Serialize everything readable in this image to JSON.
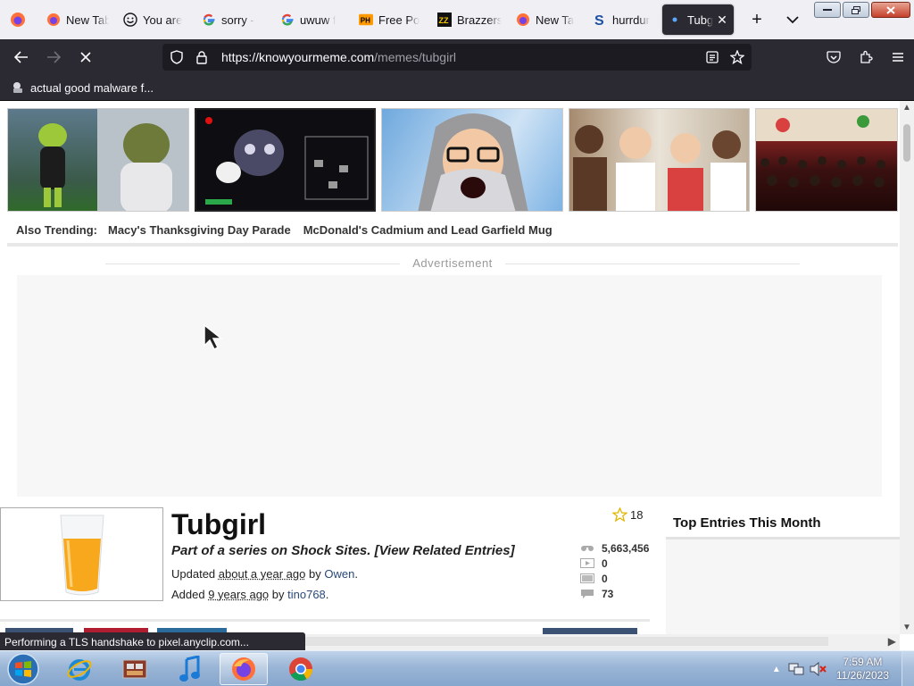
{
  "browser": {
    "tabs": [
      {
        "title": "New Tab",
        "icon": "firefox-icon",
        "width": 82
      },
      {
        "title": "You are",
        "icon": "smiley-icon",
        "width": 84
      },
      {
        "title": "sorry -",
        "icon": "google-icon",
        "width": 84
      },
      {
        "title": "uwuw f",
        "icon": "google-icon",
        "width": 84
      },
      {
        "title": "Free Po",
        "icon": "ph-icon",
        "width": 84
      },
      {
        "title": "Brazzers",
        "icon": "zz-icon",
        "width": 84
      },
      {
        "title": "New Ta",
        "icon": "firefox-icon",
        "width": 82
      },
      {
        "title": "hurrdur",
        "icon": "s-icon",
        "width": 80
      },
      {
        "title": "Tubg",
        "icon": "dot-icon",
        "width": 80,
        "active": true
      }
    ],
    "url_host": "https://knowyourmeme.com",
    "url_path": "/memes/tubgirl",
    "bookmark": "actual good malware f...",
    "status": "Performing a TLS handshake to pixel.anyclip.com..."
  },
  "page": {
    "also_trending_label": "Also Trending:",
    "trending_links": [
      "Macy's Thanksgiving Day Parade",
      "McDonald's Cadmium and Lead Garfield Mug"
    ],
    "ad_label": "Advertisement",
    "entry": {
      "title": "Tubgirl",
      "series_text": "Part of a series on Shock Sites.",
      "related_link": "[View Related Entries]",
      "updated_label": "Updated",
      "updated_when": "about a year ago",
      "updated_by_label": "by",
      "updated_by": "Owen",
      "added_label": "Added",
      "added_when": "9 years ago",
      "added_by_label": "by",
      "added_by": "tino768",
      "favorites": "18",
      "views": "5,663,456",
      "videos": "0",
      "photos": "0",
      "comments": "73"
    },
    "sidebar_title": "Top Entries This Month"
  },
  "taskbar": {
    "time": "7:59 AM",
    "date": "11/26/2023"
  },
  "colors": {
    "toolbar": "#2b2a33",
    "tabstrip": "#f0f0f4",
    "link": "#2a4a7a",
    "taskbar": "#9ab5d6"
  }
}
